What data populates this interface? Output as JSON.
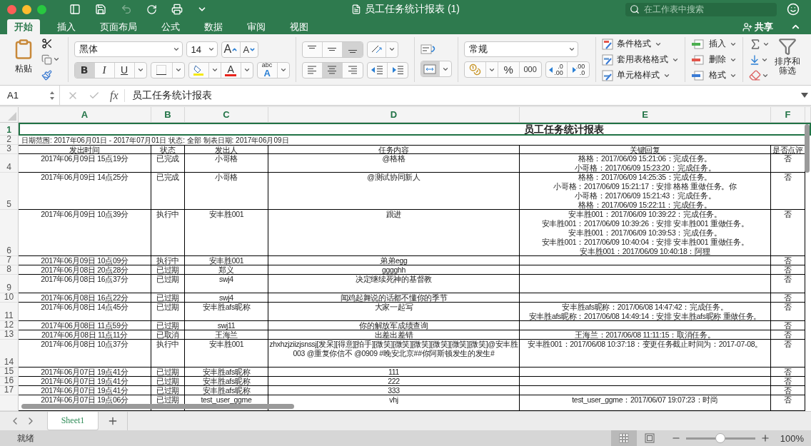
{
  "title_bar": {
    "document_title": "员工任务统计报表 (1)",
    "search_placeholder": "在工作表中搜索"
  },
  "tabs": [
    {
      "label": "开始",
      "selected": true
    },
    {
      "label": "插入",
      "selected": false
    },
    {
      "label": "页面布局",
      "selected": false
    },
    {
      "label": "公式",
      "selected": false
    },
    {
      "label": "数据",
      "selected": false
    },
    {
      "label": "审阅",
      "selected": false
    },
    {
      "label": "视图",
      "selected": false
    }
  ],
  "share_label": "共享",
  "ribbon": {
    "paste_label": "粘贴",
    "font_name": "黑体",
    "font_size": "14",
    "grow_font": "A",
    "shrink_font": "A",
    "bold": {
      "label": "B",
      "pressed": true
    },
    "italic": {
      "label": "I",
      "pressed": false
    },
    "underline": {
      "label": "U",
      "pressed": false
    },
    "font_color": "A",
    "phonetic": {
      "top": "abc",
      "bottom": "A"
    },
    "vertical_align": [
      {
        "kind": "top",
        "selected": false
      },
      {
        "kind": "middle",
        "selected": false
      },
      {
        "kind": "bottom",
        "selected": true
      }
    ],
    "horizontal_align": [
      {
        "kind": "left",
        "selected": false
      },
      {
        "kind": "center",
        "selected": true
      },
      {
        "kind": "right",
        "selected": false
      }
    ],
    "merge_center_pressed": true,
    "number_format": "常规",
    "percent": "%",
    "thousands": "000",
    "decimal_buttons": [
      {
        "top": ".0",
        "bottom": ".00"
      },
      {
        "top": ".00",
        "bottom": ".0"
      }
    ],
    "style_buttons": [
      "条件格式",
      "套用表格格式",
      "单元格样式"
    ],
    "cell_buttons": [
      "插入",
      "删除",
      "格式"
    ],
    "sort_label": "排序和筛选"
  },
  "formula_bar": {
    "cell_ref": "A1",
    "fx": "fx",
    "formula": "员工任务统计报表"
  },
  "columns": [
    {
      "label": "A",
      "selected": true
    },
    {
      "label": "B",
      "selected": true
    },
    {
      "label": "C",
      "selected": true
    },
    {
      "label": "D",
      "selected": true
    },
    {
      "label": "E",
      "selected": true
    },
    {
      "label": "F",
      "selected": true
    }
  ],
  "sheet": {
    "title_row": "1",
    "title": "员工任务统计报表",
    "title_selected": true,
    "info_row": "2",
    "info": "日期范围: 2017年06月01日 - 2017年07月01日  状态: 全部  制表日期: 2017年06月09日",
    "header_row": "3",
    "headers": [
      "发出时间",
      "状态",
      "发出人",
      "任务内容",
      "关键回复",
      "是否点评"
    ],
    "rows": [
      {
        "number": "4",
        "time": "2017年06月09日 15点19分",
        "status": "已完成",
        "sender": "小哥格",
        "task": [
          "@格格"
        ],
        "replies": [
          "格格：2017/06/09 15:21:06：完成任务。",
          "小哥格：2017/06/09 15:23:20：完成任务。"
        ],
        "reviewed": "否"
      },
      {
        "number": "5",
        "time": "2017年06月09日 14点25分",
        "status": "已完成",
        "sender": "小哥格",
        "task": [
          "@测试协同新人"
        ],
        "replies": [
          "格格：2017/06/09 14:25:35：完成任务。",
          "小哥格：2017/06/09 15:21:17：安排 格格 重做任务。你",
          "小哥格：2017/06/09 15:21:43：完成任务。",
          "格格：2017/06/09 15:22:11：完成任务。"
        ],
        "reviewed": "否"
      },
      {
        "number": "6",
        "time": "2017年06月09日 10点39分",
        "status": "执行中",
        "sender": "安丰胜001",
        "task": [
          "跟进"
        ],
        "replies": [
          "安丰胜001：2017/06/09 10:39:22：完成任务。",
          "安丰胜001：2017/06/09 10:39:26：安排 安丰胜001 重做任务。",
          "安丰胜001：2017/06/09 10:39:53：完成任务。",
          "安丰胜001：2017/06/09 10:40:04：安排 安丰胜001 重做任务。",
          "安丰胜001：2017/06/09 10:40:18：阿狸"
        ],
        "reviewed": "否"
      },
      {
        "number": "7",
        "time": "2017年06月09日 10点09分",
        "status": "执行中",
        "sender": "安丰胜001",
        "task": [
          "弟弟egg"
        ],
        "reviewed": "否"
      },
      {
        "number": "8",
        "time": "2017年06月08日 20点28分",
        "status": "已过期",
        "sender": "郑义",
        "task": [
          "gggghh"
        ],
        "reviewed": "否"
      },
      {
        "number": "9",
        "time": "2017年06月08日 16点37分",
        "status": "已过期",
        "sender": "swj4",
        "task": [
          "决定继续死神的基督教"
        ],
        "reviewed": "否"
      },
      {
        "number": "10",
        "time": "2017年06月08日 16点22分",
        "status": "已过期",
        "sender": "swj4",
        "task": [
          "闻鸡起舞说的话都不懂你的季节"
        ],
        "reviewed": "否"
      },
      {
        "number": "11",
        "time": "2017年06月08日 14点45分",
        "status": "已过期",
        "sender": "安丰胜afs昵称",
        "task": [
          "大家一起写"
        ],
        "replies": [
          "安丰胜afs昵称：2017/06/08 14:47:42：完成任务。",
          "安丰胜afs昵称：2017/06/08 14:49:14：安排 安丰胜afs昵称 重做任务。"
        ],
        "reviewed": "否"
      },
      {
        "number": "12",
        "time": "2017年06月08日 11点59分",
        "status": "已过期",
        "sender": "swj11",
        "task": [
          "你的解放军成绩查询"
        ],
        "reviewed": "否"
      },
      {
        "number": "13",
        "time": "2017年06月08日 11点11分",
        "status": "已取消",
        "sender": "王海兰",
        "task": [
          "出差出差错"
        ],
        "replies": [
          "王海兰：2017/06/08 11:11:15：取消任务。"
        ],
        "reviewed": "否"
      },
      {
        "number": "14",
        "time": "2017年06月08日 10点37分",
        "status": "执行中",
        "sender": "安丰胜001",
        "task": [
          "zhxhzjziizjsnssj[发呆][得意][拍手][微笑][微笑][微笑][微笑][微笑][微笑]@安丰胜",
          "003 @重复你信不 @0909 #晚安北京##你阿斯顿发生的发生#"
        ],
        "replies": [
          "安丰胜001：2017/06/08 10:37:18：变更任务截止时间为：2017-07-08。"
        ],
        "reviewed": "否"
      },
      {
        "number": "15",
        "time": "2017年06月07日 19点41分",
        "status": "已过期",
        "sender": "安丰胜afs昵称",
        "task": [
          "111"
        ],
        "reviewed": "否"
      },
      {
        "number": "16",
        "time": "2017年06月07日 19点41分",
        "status": "已过期",
        "sender": "安丰胜afs昵称",
        "task": [
          "222"
        ],
        "reviewed": "否"
      },
      {
        "number": "17",
        "time": "2017年06月07日 19点41分",
        "status": "已过期",
        "sender": "安丰胜afs昵称",
        "task": [
          "333"
        ],
        "reviewed": "否"
      },
      {
        "time": "2017年06月07日 19点06分",
        "status": "已过期",
        "sender": "test_user_ggme",
        "task": [
          "vhj"
        ],
        "replies": [
          "test_user_ggme：2017/06/07 19:07:23：时尚"
        ],
        "reviewed": "否"
      }
    ]
  },
  "sheet_tabs": [
    {
      "label": "Sheet1",
      "selected": true
    }
  ],
  "status": "就绪",
  "zoom": {
    "level": 0.5,
    "label": "100%"
  }
}
